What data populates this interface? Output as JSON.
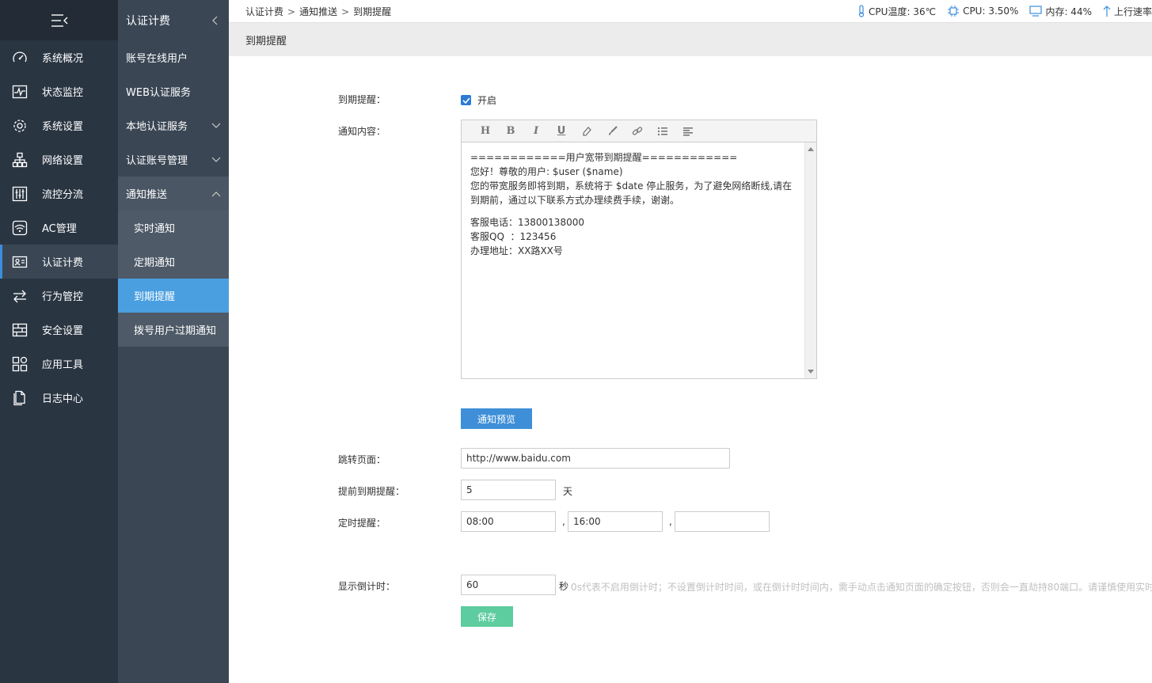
{
  "nav1": {
    "items": [
      {
        "label": "系统概况",
        "icon": "dashboard-icon"
      },
      {
        "label": "状态监控",
        "icon": "pulse-icon"
      },
      {
        "label": "系统设置",
        "icon": "gear-icon"
      },
      {
        "label": "网络设置",
        "icon": "network-icon"
      },
      {
        "label": "流控分流",
        "icon": "sliders-icon"
      },
      {
        "label": "AC管理",
        "icon": "wifi-icon"
      },
      {
        "label": "认证计费",
        "icon": "id-card-icon"
      },
      {
        "label": "行为管控",
        "icon": "arrows-icon"
      },
      {
        "label": "安全设置",
        "icon": "firewall-icon"
      },
      {
        "label": "应用工具",
        "icon": "apps-icon"
      },
      {
        "label": "日志中心",
        "icon": "document-icon"
      }
    ]
  },
  "nav2": {
    "title": "认证计费",
    "items": [
      {
        "label": "账号在线用户"
      },
      {
        "label": "WEB认证服务"
      },
      {
        "label": "本地认证服务"
      },
      {
        "label": "认证账号管理"
      },
      {
        "label": "通知推送"
      }
    ],
    "subitems": [
      {
        "label": "实时通知"
      },
      {
        "label": "定期通知"
      },
      {
        "label": "到期提醒"
      },
      {
        "label": "拨号用户过期通知"
      }
    ]
  },
  "breadcrumb": {
    "a": "认证计费",
    "b": "通知推送",
    "c": "到期提醒",
    "sep": ">"
  },
  "stats": {
    "cpu_temp": "CPU温度: 36℃",
    "cpu": "CPU: 3.50%",
    "mem": "内存: 44%",
    "up": "上行速率"
  },
  "page_title": "到期提醒",
  "form": {
    "reminder_label": "到期提醒：",
    "reminder_check": "开启",
    "content_label": "通知内容：",
    "content_lines": [
      "============用户宽带到期提醒============",
      "您好！尊敬的用户: $user ($name)",
      "您的带宽服务即将到期，系统将于 $date 停止服务，为了避免网络断线,请在到期前，通过以下联系方式办理续费手续，谢谢。",
      "客服电话：13800138000",
      "客服QQ  ：123456",
      "办理地址：XX路XX号"
    ],
    "preview_button": "通知预览",
    "redirect_label": "跳转页面：",
    "redirect_value": "http://www.baidu.com",
    "advance_label": "提前到期提醒：",
    "advance_value": "5",
    "advance_unit": "天",
    "timer_label": "定时提醒：",
    "timer1": "08:00",
    "timer2": "16:00",
    "timer3": "",
    "comma": ",",
    "countdown_label": "显示倒计时：",
    "countdown_value": "60",
    "countdown_unit": "秒",
    "countdown_hint": "0s代表不启用倒计时；不设置倒计时时间，或在倒计时时间内，需手动点击通知页面的确定按钮，否则会一直劫持80端口。请谨慎使用实时",
    "save_button": "保存"
  }
}
